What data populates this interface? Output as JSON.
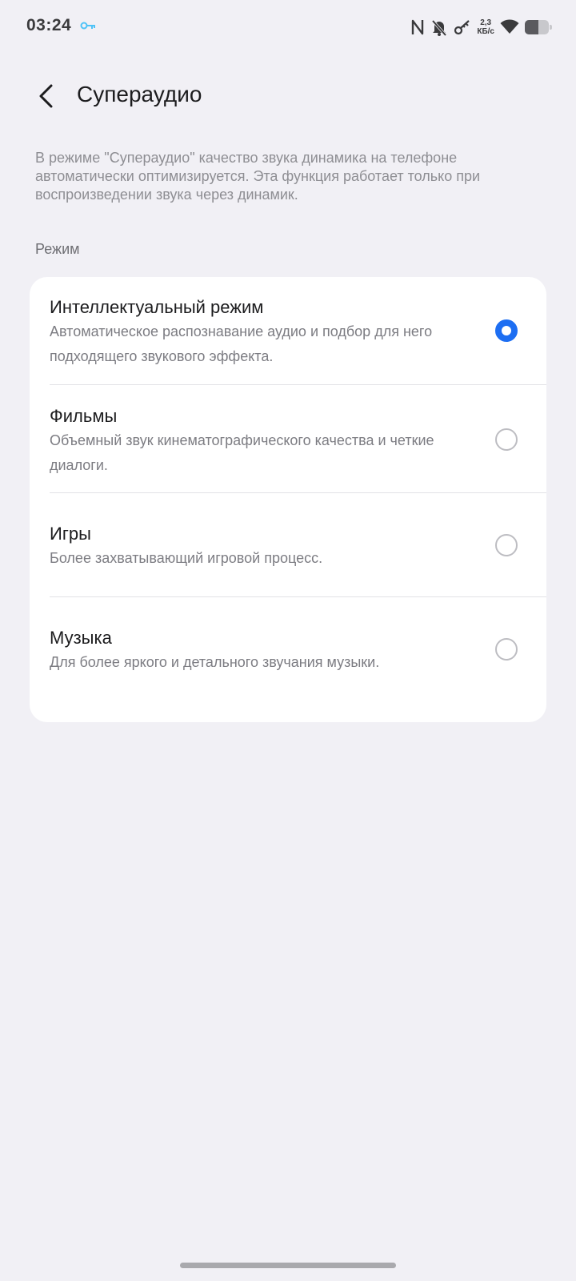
{
  "status_bar": {
    "time": "03:24",
    "net_speed_value": "2,3",
    "net_speed_unit": "КБ/с",
    "battery_level": 0.55,
    "icons": [
      "vpn-key-icon",
      "nfc-icon",
      "bell-muted-icon",
      "key-icon",
      "wifi-icon",
      "battery-icon"
    ],
    "accent_color": "#4fc3f7"
  },
  "header": {
    "title": "Супераудио"
  },
  "description": "В режиме \"Супераудио\" качество звука динамика на телефоне автоматически оптимизируется. Эта функция работает только при воспроизведении звука через динамик.",
  "section": {
    "label": "Режим"
  },
  "modes": [
    {
      "title": "Интеллектуальный режим",
      "subtitle": "Автоматическое распознавание аудио и подбор для него подходящего звукового эффекта.",
      "selected": true
    },
    {
      "title": "Фильмы",
      "subtitle": "Объемный звук кинематографического качества и четкие диалоги.",
      "selected": false
    },
    {
      "title": "Игры",
      "subtitle": "Более захватывающий игровой процесс.",
      "selected": false
    },
    {
      "title": "Музыка",
      "subtitle": "Для более яркого и детального звучания музыки.",
      "selected": false
    }
  ],
  "colors": {
    "background": "#f1f0f5",
    "card": "#ffffff",
    "radio_selected": "#1d6ef2",
    "radio_unselected": "#bdbdc2"
  }
}
